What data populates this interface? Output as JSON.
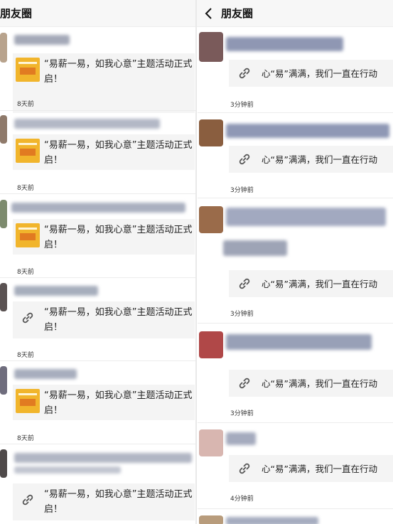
{
  "left_header": {
    "title": "朋友圈"
  },
  "right_header": {
    "title": "朋友圈"
  },
  "left_posts": [
    {
      "card_kind": "image",
      "text": "“易薪一易，如我心意”主题活动正式启！",
      "time": "8天前"
    },
    {
      "card_kind": "image",
      "text": "“易薪一易，如我心意”主题活动正式启！",
      "time": "8天前"
    },
    {
      "card_kind": "image",
      "text": "“易薪一易，如我心意”主题活动正式启！",
      "time": "8天前"
    },
    {
      "card_kind": "link",
      "text": "“易薪一易，如我心意”主题活动正式启！",
      "time": "8天前"
    },
    {
      "card_kind": "image",
      "text": "“易薪一易，如我心意”主题活动正式启！",
      "time": "8天前"
    },
    {
      "card_kind": "link",
      "text": "“易薪一易，如我心意”主题活动正式启！",
      "time": ""
    }
  ],
  "right_posts": [
    {
      "text": "心“易”满满，我们一直在行动",
      "time": "3分钟前"
    },
    {
      "text": "心“易”满满，我们一直在行动",
      "time": "3分钟前"
    },
    {
      "text": "心“易”满满，我们一直在行动",
      "time": "3分钟前"
    },
    {
      "text": "心“易”满满，我们一直在行动",
      "time": "3分钟前"
    },
    {
      "text": "心“易”满满，我们一直在行动",
      "time": "4分钟前"
    }
  ],
  "colors": {
    "card_bg": "#f4f4f4",
    "thumb_yellow": "#f1b52c",
    "divider": "#e9e9e9"
  },
  "icons": {
    "back": "chevron-left-icon",
    "link": "link-icon"
  }
}
